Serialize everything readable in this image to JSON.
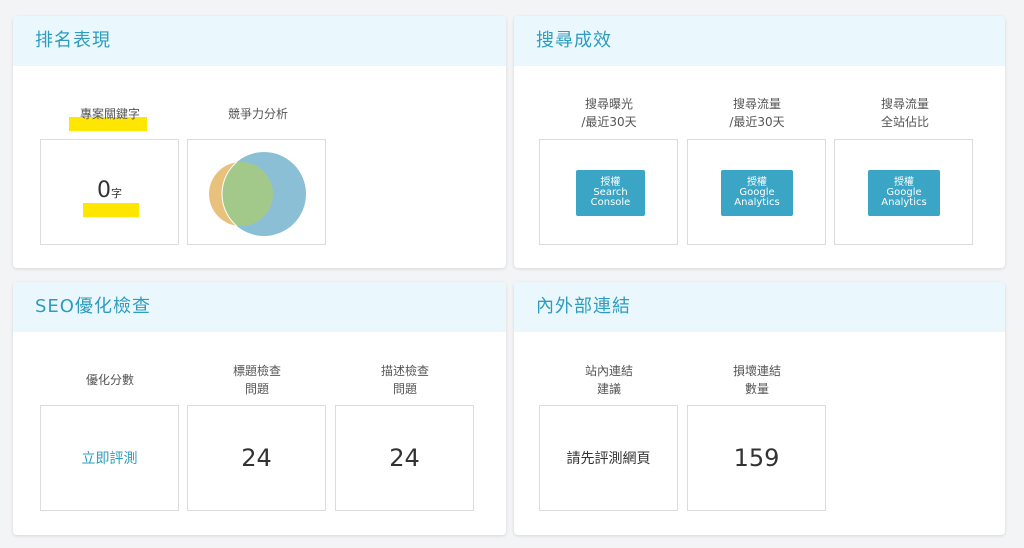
{
  "ranking": {
    "title": "排名表現",
    "keywords_label": "專案關鍵字",
    "competition_label": "競爭力分析",
    "keywords_count": "0",
    "keywords_unit": "字",
    "venn": {
      "left_color": "#e8c27c",
      "right_color": "#8bbfd6",
      "overlap_color": "#a3c98a"
    }
  },
  "search": {
    "title": "搜尋成效",
    "columns": [
      {
        "line1": "搜尋曝光",
        "line2": "/最近30天",
        "btn": [
          "授權",
          "Search",
          "Console"
        ]
      },
      {
        "line1": "搜尋流量",
        "line2": "/最近30天",
        "btn": [
          "授權",
          "Google",
          "Analytics"
        ]
      },
      {
        "line1": "搜尋流量",
        "line2": "全站佔比",
        "btn": [
          "授權",
          "Google",
          "Analytics"
        ]
      }
    ]
  },
  "seo": {
    "title": "SEO優化檢查",
    "columns": [
      {
        "line1": "優化分數",
        "line2": "",
        "value": "立即評測"
      },
      {
        "line1": "標題檢查",
        "line2": "問題",
        "value": "24"
      },
      {
        "line1": "描述檢查",
        "line2": "問題",
        "value": "24"
      }
    ]
  },
  "links": {
    "title": "內外部連結",
    "columns": [
      {
        "line1": "站內連結",
        "line2": "建議",
        "value": "請先評測網頁"
      },
      {
        "line1": "損壞連結",
        "line2": "數量",
        "value": "159"
      }
    ]
  },
  "colors": {
    "accent": "#2e9cbf",
    "header_bg": "#eaf8fd",
    "button": "#3aa5c4",
    "highlight": "#ffe600"
  }
}
